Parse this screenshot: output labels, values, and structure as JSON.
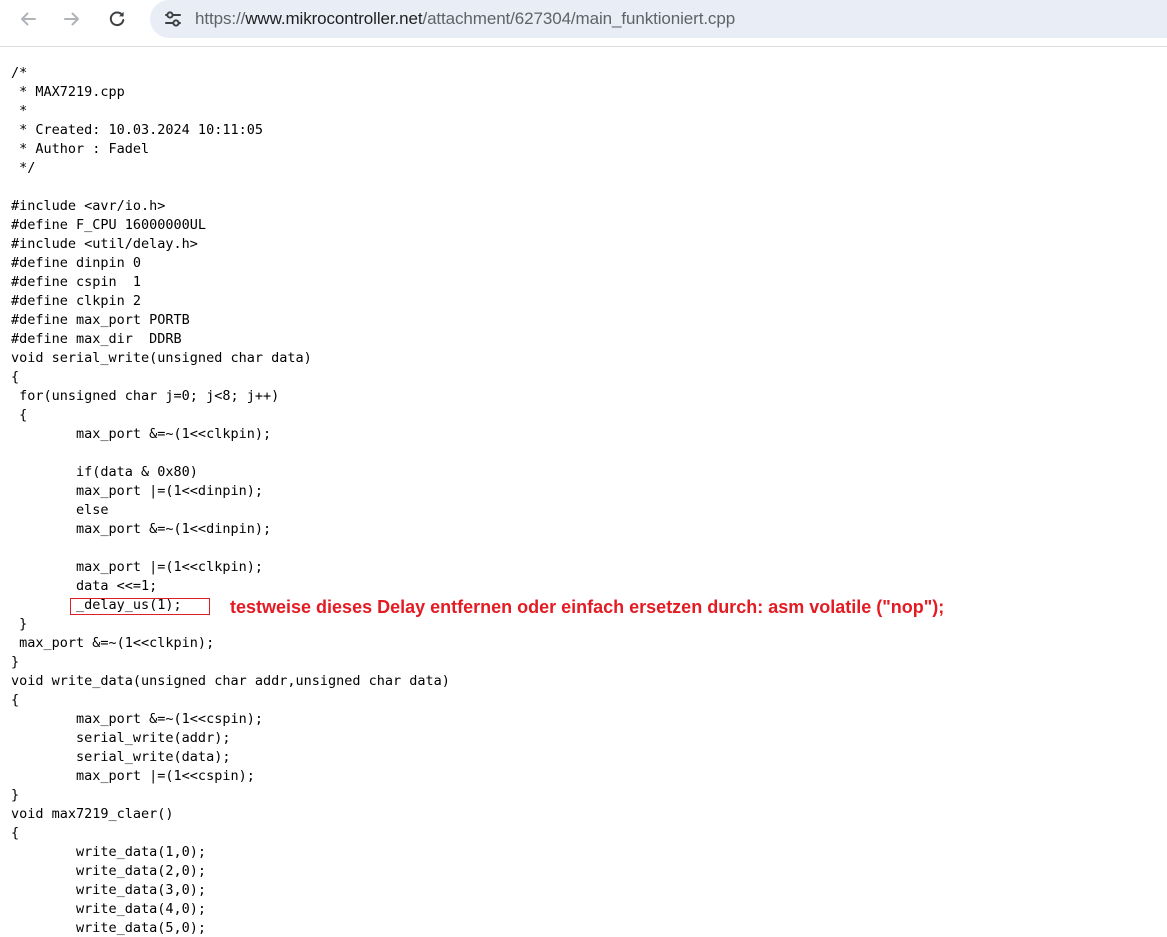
{
  "browser": {
    "url_scheme": "https://",
    "url_host": "www.mikrocontroller.net",
    "url_path": "/attachment/627304/main_funktioniert.cpp",
    "icons": {
      "back": "arrow-left-icon",
      "forward": "arrow-right-icon",
      "reload": "reload-icon",
      "site_info": "tune-icon"
    }
  },
  "code": "/*\n * MAX7219.cpp\n *\n * Created: 10.03.2024 10:11:05\n * Author : Fadel\n */\n\n#include <avr/io.h>\n#define F_CPU 16000000UL\n#include <util/delay.h>\n#define dinpin 0\n#define cspin  1\n#define clkpin 2\n#define max_port PORTB\n#define max_dir  DDRB\nvoid serial_write(unsigned char data)\n{\n for(unsigned char j=0; j<8; j++)\n {\n        max_port &=~(1<<clkpin);\n\n        if(data & 0x80)\n        max_port |=(1<<dinpin);\n        else\n        max_port &=~(1<<dinpin);\n\n        max_port |=(1<<clkpin);\n        data <<=1;\n        _delay_us(1);\n }\n max_port &=~(1<<clkpin);\n}\nvoid write_data(unsigned char addr,unsigned char data)\n{\n        max_port &=~(1<<cspin);\n        serial_write(addr);\n        serial_write(data);\n        max_port |=(1<<cspin);\n}\nvoid max7219_claer()\n{\n        write_data(1,0);\n        write_data(2,0);\n        write_data(3,0);\n        write_data(4,0);\n        write_data(5,0);",
  "annotation": {
    "text": "testweise dieses Delay entfernen oder einfach ersetzen durch: asm volatile (\"nop\");",
    "color": "#e31b23"
  }
}
